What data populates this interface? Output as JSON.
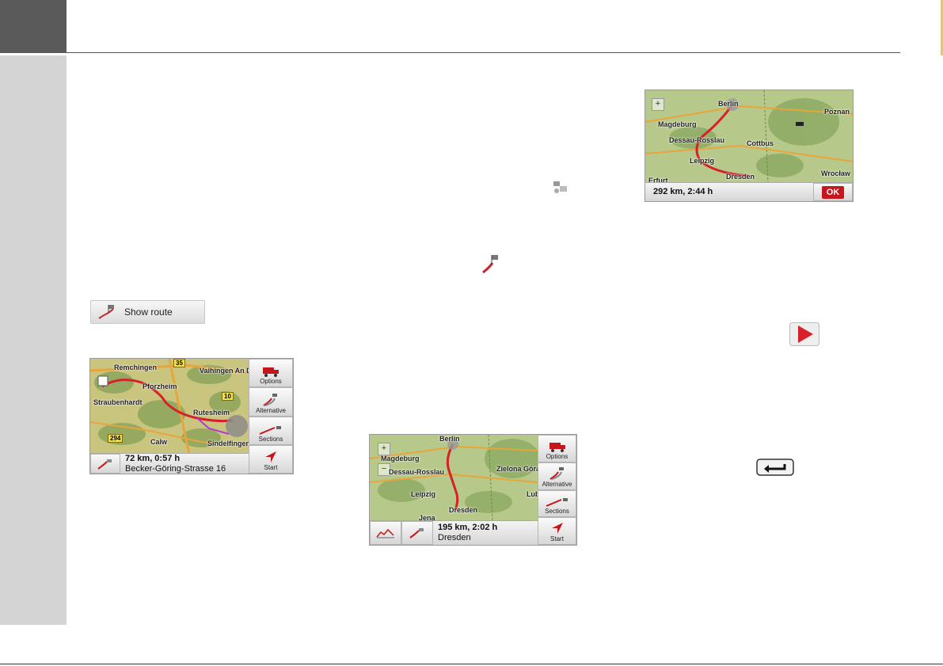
{
  "show_route_button": {
    "label": "Show route",
    "icon": "route-flag-icon"
  },
  "screen1": {
    "labels": [
      "Remchingen",
      "Vaihingen An D",
      "Pforzheim",
      "Straubenhardt",
      "Rutesheim",
      "Calw",
      "Sindelfingen"
    ],
    "road_numbers": [
      "35",
      "10",
      "294"
    ],
    "side_buttons": {
      "options": "Options",
      "alternative": "Alternative",
      "sections": "Sections",
      "start": "Start"
    },
    "distance_time": "72 km, 0:57 h",
    "destination": "Becker-Göring-Strasse 16"
  },
  "screen2": {
    "labels": [
      "Berlin",
      "Magdeburg",
      "Dessau-Rosslau",
      "Zielona Góra",
      "Leipzig",
      "Lub",
      "Dresden",
      "Jena"
    ],
    "zoom_in": "+",
    "zoom_out": "−",
    "side_buttons": {
      "options": "Options",
      "alternative": "Alternative",
      "sections": "Sections",
      "start": "Start"
    },
    "distance_time": "195 km, 2:02 h",
    "destination": "Dresden"
  },
  "screen3": {
    "labels": [
      "Berlin",
      "Poznan",
      "Magdeburg",
      "Dessau-Rosslau",
      "Cottbus",
      "Leipzig",
      "Dresden",
      "Wrocław",
      "Erfurt"
    ],
    "zoom_in": "+",
    "distance_time": "292 km, 2:44 h",
    "ok_label": "OK"
  },
  "colors": {
    "corner": "#5a5a5a",
    "sidebar": "#d4d4d4",
    "route": "#d6202a",
    "ok_red": "#c4161c"
  }
}
